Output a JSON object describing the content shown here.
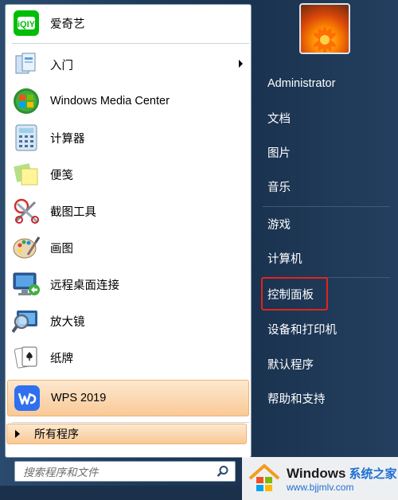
{
  "left_items": [
    {
      "label": "爱奇艺",
      "icon": "iqiyi-icon"
    },
    {
      "label": "入门",
      "icon": "getting-started-icon",
      "has_arrow": true
    },
    {
      "label": "Windows Media Center",
      "icon": "windows-media-center-icon"
    },
    {
      "label": "计算器",
      "icon": "calculator-icon"
    },
    {
      "label": "便笺",
      "icon": "sticky-notes-icon"
    },
    {
      "label": "截图工具",
      "icon": "snipping-tool-icon"
    },
    {
      "label": "画图",
      "icon": "paint-icon"
    },
    {
      "label": "远程桌面连接",
      "icon": "remote-desktop-icon"
    },
    {
      "label": "放大镜",
      "icon": "magnifier-icon"
    },
    {
      "label": "纸牌",
      "icon": "solitaire-icon"
    },
    {
      "label": "WPS 2019",
      "icon": "wps-icon",
      "highlighted": true
    }
  ],
  "all_programs": {
    "label": "所有程序"
  },
  "search": {
    "placeholder": "搜索程序和文件"
  },
  "right_items": [
    {
      "label": "Administrator"
    },
    {
      "label": "文档"
    },
    {
      "label": "图片"
    },
    {
      "label": "音乐"
    },
    {
      "label": "游戏"
    },
    {
      "label": "计算机"
    },
    {
      "label": "控制面板",
      "highlighted": true
    },
    {
      "label": "设备和打印机"
    },
    {
      "label": "默认程序"
    },
    {
      "label": "帮助和支持"
    }
  ],
  "watermark": {
    "brand": "Windows",
    "brand_cn": "系统之家",
    "url": "www.bjjmlv.com"
  },
  "colors": {
    "highlight": "#f9c996",
    "red_box": "#e3241b",
    "watermark_blue": "#1f6fd1"
  }
}
